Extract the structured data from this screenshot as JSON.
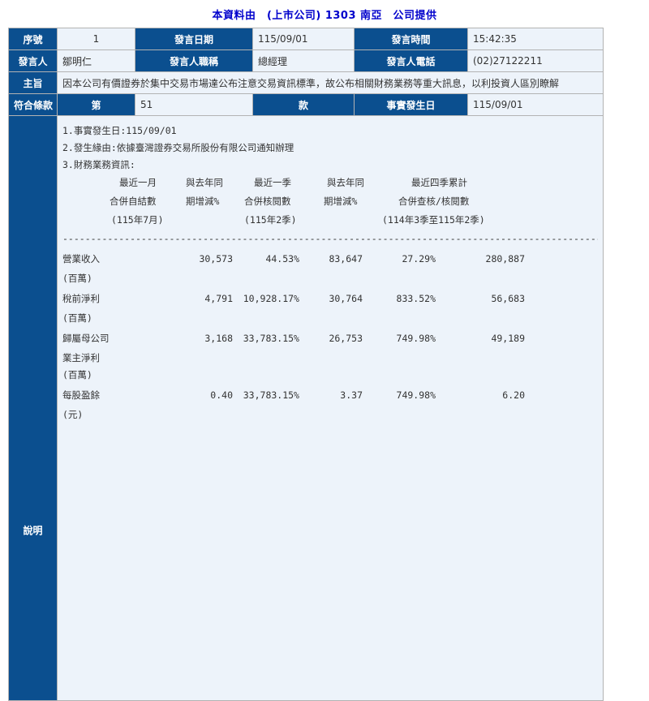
{
  "title": "本資料由　(上市公司) 1303 南亞　公司提供",
  "labels": {
    "seq": "序號",
    "speaker": "發言人",
    "subject": "主旨",
    "clause": "符合條款",
    "explain": "說明",
    "date": "發言日期",
    "title_role": "發言人職稱",
    "item": "第",
    "para": "款",
    "time": "發言時間",
    "phone": "發言人電話",
    "event_date": "事實發生日"
  },
  "values": {
    "seq": "1",
    "date": "115/09/01",
    "time": "15:42:35",
    "speaker": "鄒明仁",
    "role": "總經理",
    "phone": "(02)27122211",
    "subject": "因本公司有價證券於集中交易市場達公布注意交易資訊標準，故公布相關財務業務等重大訊息，以利投資人區別瞭解",
    "clause_no": "51",
    "event_date": "115/09/01"
  },
  "body": {
    "line1": "1.事實發生日:115/09/01",
    "line2": "2.發生緣由:依據臺灣證券交易所股份有限公司通知辦理",
    "line3": "3.財務業務資訊:",
    "headers": [
      [
        "最近一月",
        "合併自結數",
        "(115年7月)"
      ],
      [
        "與去年同",
        "期增減%",
        ""
      ],
      [
        "最近一季",
        "合併核閱數",
        "(115年2季)"
      ],
      [
        "與去年同",
        "期增減%",
        ""
      ],
      [
        "最近四季累計",
        "合併查核/核閱數",
        "(114年3季至115年2季)"
      ]
    ],
    "dashes": "------------------------------------------------------------------------------------------------------",
    "rows": [
      {
        "label": "營業收入",
        "unit": "(百萬)",
        "v1": "30,573",
        "v2": "44.53%",
        "v3": "83,647",
        "v4": "27.29%",
        "v5": "280,887"
      },
      {
        "label": "稅前淨利",
        "unit": "(百萬)",
        "v1": "4,791",
        "v2": "10,928.17%",
        "v3": "30,764",
        "v4": "833.52%",
        "v5": "56,683"
      },
      {
        "label": "歸屬母公司",
        "label2": "業主淨利",
        "unit": "(百萬)",
        "v1": "3,168",
        "v2": "33,783.15%",
        "v3": "26,753",
        "v4": "749.98%",
        "v5": "49,189"
      },
      {
        "label": "每股盈餘",
        "unit": "(元)",
        "v1": "0.40",
        "v2": "33,783.15%",
        "v3": "3.37",
        "v4": "749.98%",
        "v5": "6.20"
      }
    ]
  }
}
